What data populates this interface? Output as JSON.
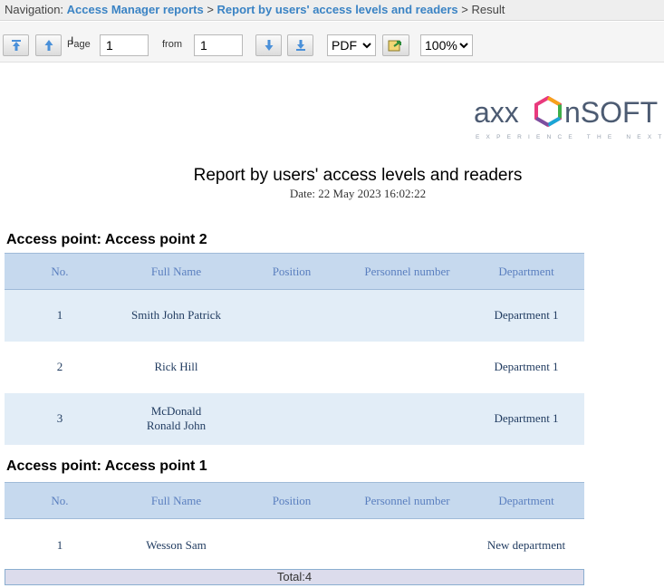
{
  "nav": {
    "prefix": "Navigation:",
    "link1": "Access Manager reports",
    "sep1": ">",
    "link2": "Report by users' access levels and readers",
    "sep2": ">",
    "current": "Result"
  },
  "toolbar": {
    "page_label": "Page",
    "page_value": "1",
    "from_label": "from",
    "from_value": "1",
    "format_selected": "PDF",
    "zoom_selected": "100%"
  },
  "logo": {
    "text": "axxonsoft",
    "tagline": "EXPERIENCE THE NEXT"
  },
  "report": {
    "title": "Report by users' access levels and readers",
    "date": "Date: 22 May 2023 16:02:22"
  },
  "columns": [
    "No.",
    "Full Name",
    "Position",
    "Personnel number",
    "Department"
  ],
  "sections": [
    {
      "title": "Access point: Access point 2",
      "rows": [
        [
          "1",
          "Smith John Patrick",
          "",
          "",
          "Department 1"
        ],
        [
          "2",
          "Rick Hill",
          "",
          "",
          "Department 1"
        ],
        [
          "3",
          "McDonald Ronald John",
          "",
          "",
          "Department 1"
        ]
      ]
    },
    {
      "title": "Access point: Access point 1",
      "rows": [
        [
          "1",
          "Wesson Sam",
          "",
          "",
          "New department"
        ]
      ]
    }
  ],
  "total": "Total:4",
  "colors": {
    "nav_link": "#3a83c4",
    "header_bg": "#c6d9ee",
    "header_text": "#5a7fbf",
    "row_alt_bg": "#e2edf7",
    "total_bg": "#dcdcec"
  }
}
